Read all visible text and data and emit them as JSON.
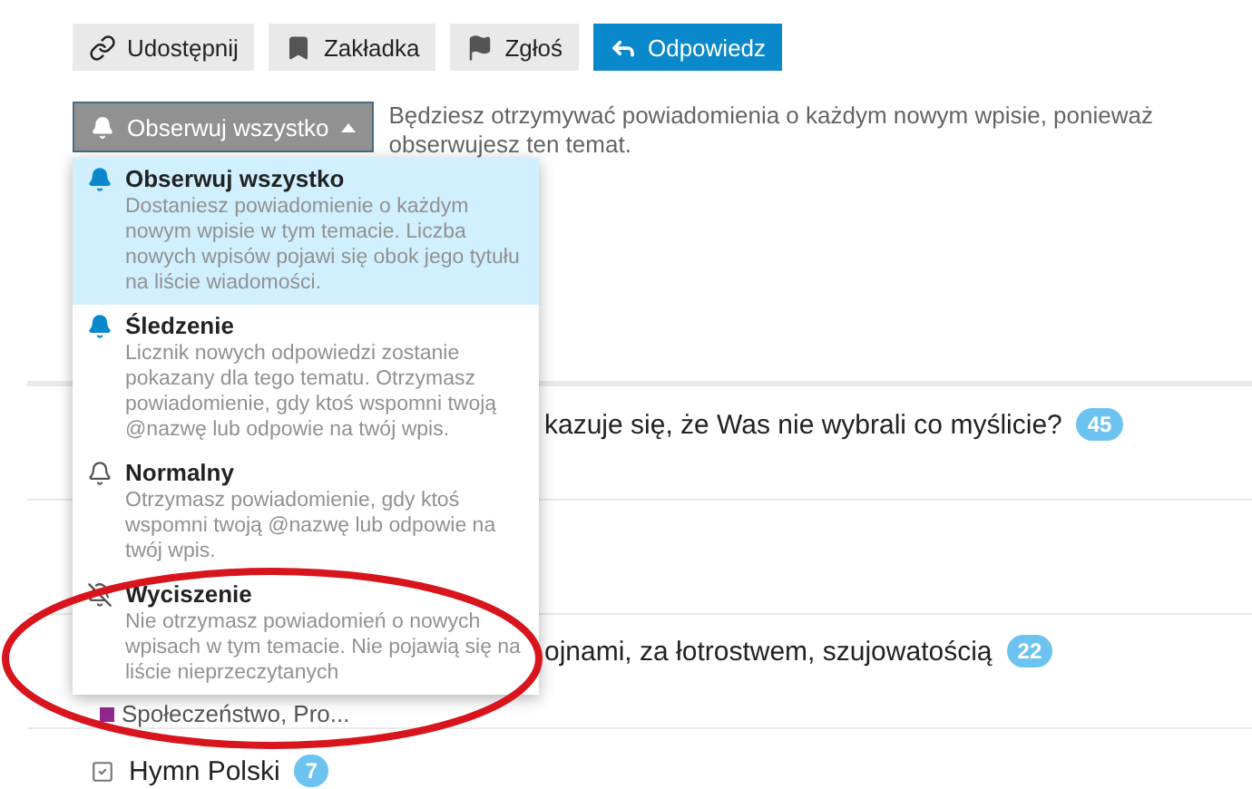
{
  "actions": [
    {
      "label": "Udostępnij",
      "kind": "share",
      "primary": false
    },
    {
      "label": "Zakładka",
      "kind": "bookmark",
      "primary": false
    },
    {
      "label": "Zgłoś",
      "kind": "flag",
      "primary": false
    },
    {
      "label": "Odpowiedz",
      "kind": "reply",
      "primary": true
    }
  ],
  "notification": {
    "button": "Obserwuj wszystko",
    "description": "Będziesz otrzymywać powiadomienia o każdym nowym wpisie, ponieważ obserwujesz ten temat.",
    "menu_open": true
  },
  "menu": [
    {
      "kind": "watching",
      "title": "Obserwuj wszystko",
      "description": "Dostaniesz powiadomienie o każdym nowym wpisie w tym temacie. Liczba nowych wpisów pojawi się obok jego tytułu na liście wiadomości.",
      "selected": true
    },
    {
      "kind": "tracking",
      "title": "Śledzenie",
      "description": "Licznik nowych odpowiedzi zostanie pokazany dla tego tematu. Otrzymasz powiadomienie, gdy ktoś wspomni twoją @nazwę lub odpowie na twój wpis.",
      "selected": false
    },
    {
      "kind": "regular",
      "title": "Normalny",
      "description": "Otrzymasz powiadomienie, gdy ktoś wspomni twoją @nazwę lub odpowie na twój wpis.",
      "selected": false
    },
    {
      "kind": "muted",
      "title": "Wyciszenie",
      "description": "Nie otrzymasz powiadomień o nowych wpisach w tym temacie. Nie pojawią się na liście nieprzeczytanych",
      "selected": false
    }
  ],
  "topics": [
    {
      "title": "kazuje się, że Was nie wybrali co myślicie?",
      "count": "45",
      "covered": true
    },
    {
      "title": "ojnami, za łotrostwem, szujowatością",
      "count": "22",
      "covered": true,
      "category": {
        "name": "Społeczeństwo, Pro...",
        "color": "#92278f"
      }
    },
    {
      "title": "Hymn Polski",
      "count": "7",
      "covered": false,
      "closed": true
    }
  ]
}
